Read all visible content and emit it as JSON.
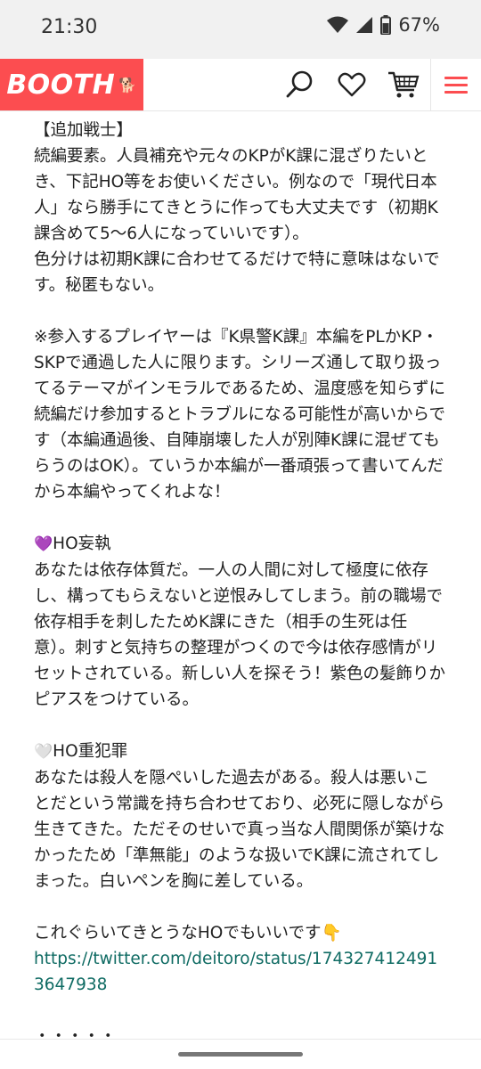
{
  "status": {
    "time": "21:30",
    "battery": "67%"
  },
  "header": {
    "logo": "BOOTH",
    "icons": [
      "search-icon",
      "heart-icon",
      "cart-icon",
      "menu-icon"
    ],
    "brand_color": "#fc4d50"
  },
  "content": {
    "heading": "【追加戦士】",
    "p1": "続編要素。人員補充や元々のKPがK課に混ざりたいとき、下記HO等をお使いください。例なので「現代日本人」なら勝手にてきとうに作っても大丈夫です（初期K課含めて5〜6人になっていいです）。\n色分けは初期K課に合わせてるだけで特に意味はないです。秘匿もない。",
    "p2": "※参入するプレイヤーは『K県警K課』本編をPLかKP・SKPで通過した人に限ります。シリーズ通して取り扱ってるテーマがインモラルであるため、温度感を知らずに続編だけ参加するとトラブルになる可能性が高いからです（本編通過後、自陣崩壊した人が別陣K課に混ぜてもらうのはOK）。ていうか本編が一番頑張って書いてんだから本編やってくれよな！",
    "ho1_heart": "💜",
    "ho1_title": "HO妄執",
    "ho1_body": "あなたは依存体質だ。一人の人間に対して極度に依存し、構ってもらえないと逆恨みしてしまう。前の職場で依存相手を刺したためK課にきた（相手の生死は任意）。刺すと気持ちの整理がつくので今は依存感情がリセットされている。新しい人を探そう！紫色の髪飾りかピアスをつけている。",
    "ho2_heart": "🤍",
    "ho2_title": "HO重犯罪",
    "ho2_body": "あなたは殺人を隠ぺいした過去がある。殺人は悪いことだという常識を持ち合わせており、必死に隠しながら生きてきた。ただそのせいで真っ当な人間関係が築けなかったため「準無能」のような扱いでK課に流されてしまった。白いペンを胸に差している。",
    "closing": "これぐらいてきとうなHOでもいいです👇",
    "link": "https://twitter.com/deitoro/status/1743274124913647938",
    "ellipsis": "・・・・・"
  }
}
